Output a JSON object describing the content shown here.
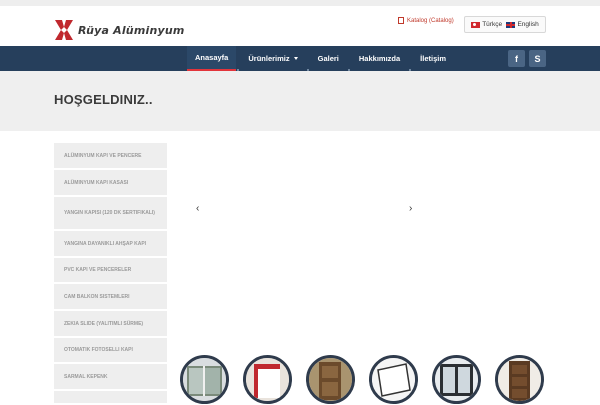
{
  "header": {
    "brand_name": "Rüya Alüminyum",
    "catalog_label": "Katalog (Catalog)",
    "languages": [
      {
        "label": "Türkçe",
        "flag_icon": "turkey-flag-icon"
      },
      {
        "label": "English",
        "flag_icon": "uk-flag-icon"
      }
    ]
  },
  "nav": {
    "items": [
      {
        "label": "Anasayfa",
        "active": true
      },
      {
        "label": "Ürünlerimiz",
        "has_dropdown": true
      },
      {
        "label": "Galeri"
      },
      {
        "label": "Hakkımızda"
      },
      {
        "label": "İletişim"
      }
    ],
    "social": [
      {
        "icon": "facebook-icon",
        "glyph": "f"
      },
      {
        "icon": "skype-icon",
        "glyph": "S"
      }
    ]
  },
  "page": {
    "welcome_title": "HOŞGELDINIZ.."
  },
  "sidebar": {
    "items": [
      {
        "label": "ALÜMINYUM KAPI VE PENCERE"
      },
      {
        "label": "ALÜMINYUM KAPI KASASI"
      },
      {
        "label": "YANGIN KAPISI (120 DK SERTIFIKALI)"
      },
      {
        "label": "YANGINA DAYANIKLI AHŞAP KAPI"
      },
      {
        "label": "PVC KAPI VE PENCERELER"
      },
      {
        "label": "CAM BALKON SISTEMLERI"
      },
      {
        "label": "ZEKIA SLIDE (YALITIMLI SÜRME)"
      },
      {
        "label": "OTOMATIK FOTOSELLI KAPI"
      },
      {
        "label": "SARMAL KEPENK"
      },
      {
        "label": ""
      }
    ]
  },
  "slider": {
    "prev_glyph": "‹",
    "next_glyph": "›"
  },
  "thumbnails": [
    {
      "name": "thumb-1"
    },
    {
      "name": "thumb-2"
    },
    {
      "name": "thumb-3"
    },
    {
      "name": "thumb-4"
    },
    {
      "name": "thumb-5"
    },
    {
      "name": "thumb-6"
    }
  ],
  "colors": {
    "nav_bg": "#263f5c",
    "accent_red": "#e2343b",
    "sidebar_bg": "#eeeeee"
  }
}
